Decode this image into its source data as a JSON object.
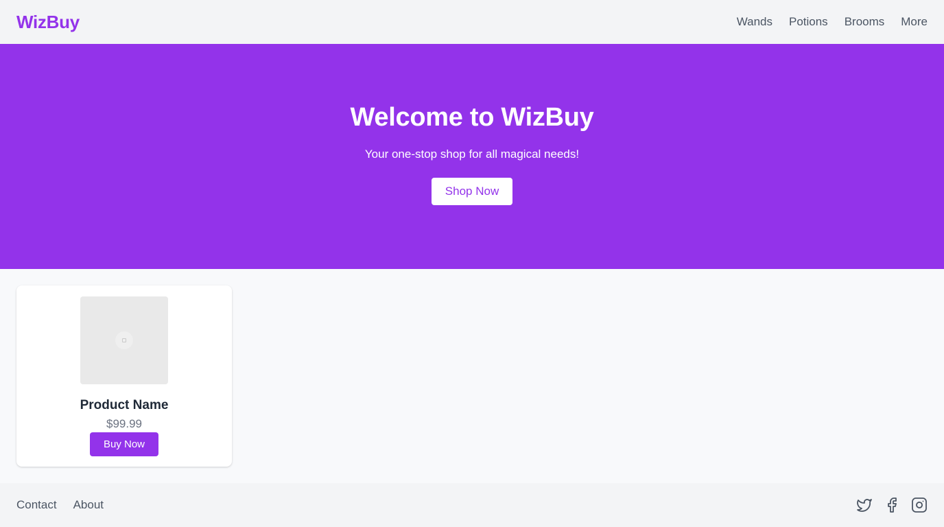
{
  "navbar": {
    "brand": "WizBuy",
    "links": [
      "Wands",
      "Potions",
      "Brooms",
      "More"
    ]
  },
  "hero": {
    "title": "Welcome to WizBuy",
    "subtitle": "Your one-stop shop for all magical needs!",
    "cta_label": "Shop Now"
  },
  "products": [
    {
      "name": "Product Name",
      "price": "$99.99",
      "buy_label": "Buy Now",
      "image_icon": "image-placeholder-icon"
    }
  ],
  "footer": {
    "links": [
      "Contact",
      "About"
    ],
    "social_icons": [
      "twitter-icon",
      "facebook-icon",
      "instagram-icon"
    ]
  },
  "colors": {
    "brand": "#9333ea",
    "navbar_bg": "#f3f4f6",
    "page_bg": "#f8f9fb",
    "text_muted": "#4b5563"
  }
}
